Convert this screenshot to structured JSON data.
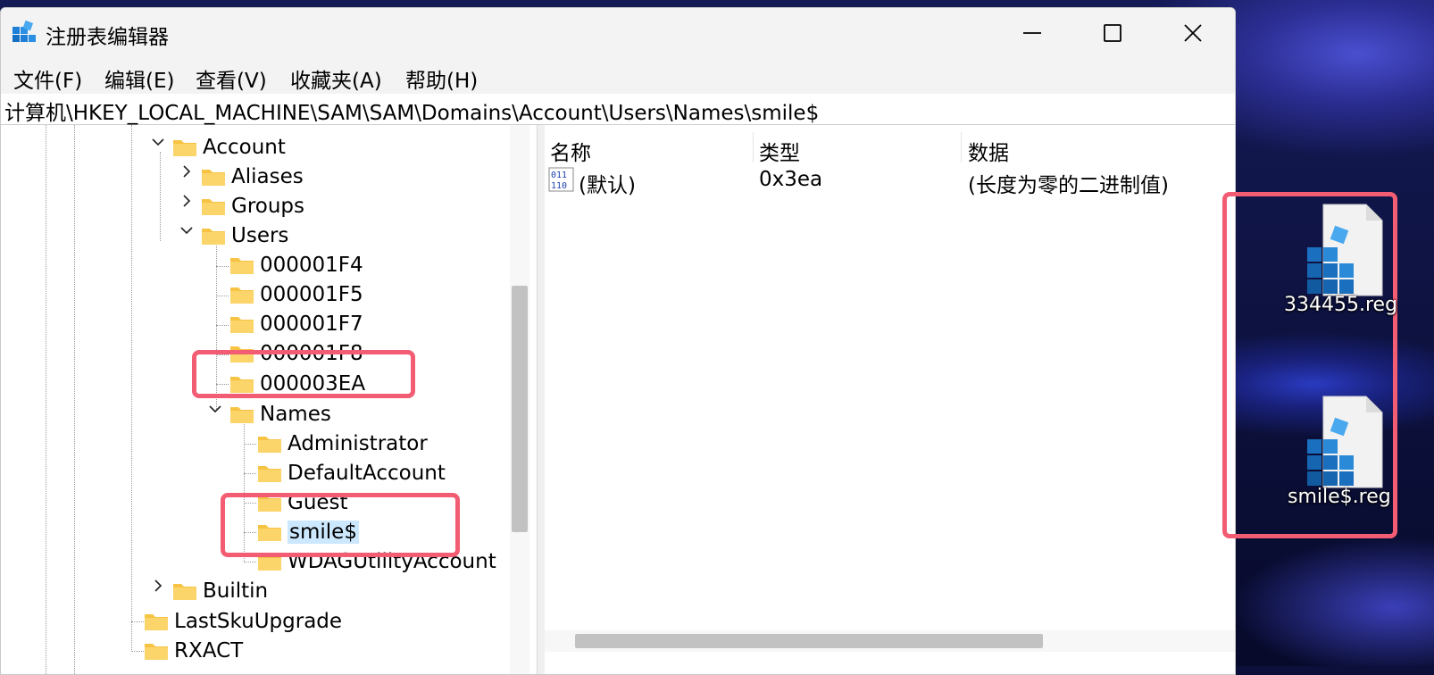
{
  "window": {
    "title": "注册表编辑器"
  },
  "menu": {
    "file": "文件(F)",
    "edit": "编辑(E)",
    "view": "查看(V)",
    "favorites": "收藏夹(A)",
    "help": "帮助(H)"
  },
  "address": "计算机\\HKEY_LOCAL_MACHINE\\SAM\\SAM\\Domains\\Account\\Users\\Names\\smile$",
  "tree": {
    "account": "Account",
    "aliases": "Aliases",
    "groups": "Groups",
    "users": "Users",
    "u1f4": "000001F4",
    "u1f5": "000001F5",
    "u1f7": "000001F7",
    "u1f8": "000001F8",
    "u3ea": "000003EA",
    "names": "Names",
    "administrator": "Administrator",
    "defaultaccount": "DefaultAccount",
    "guest": "Guest",
    "smile": "smile$",
    "wdag": "WDAGUtilityAccount",
    "builtin": "Builtin",
    "lastsku": "LastSkuUpgrade",
    "rxact": "RXACT"
  },
  "list": {
    "headers": {
      "name": "名称",
      "type": "类型",
      "data": "数据"
    },
    "rows": [
      {
        "name": "(默认)",
        "type": "0x3ea",
        "data": "(长度为零的二进制值)"
      }
    ]
  },
  "desktop": {
    "icon1_label": "334455.reg",
    "icon2_label": "smile$.reg"
  },
  "colors": {
    "highlight": "#f25d73",
    "selected_bg": "#cce8ff",
    "folder": "#f6c343"
  }
}
